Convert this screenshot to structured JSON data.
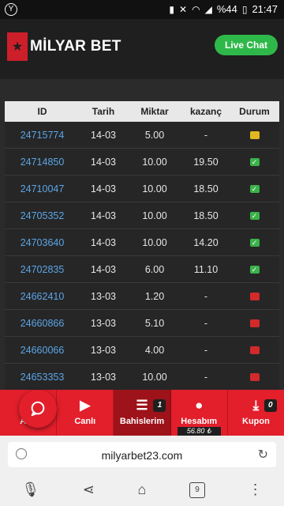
{
  "status_bar": {
    "battery": "%44",
    "time": "21:47"
  },
  "header": {
    "brand": "MİLYAR BET",
    "live_chat": "Live Chat"
  },
  "table": {
    "columns": [
      "ID",
      "Tarih",
      "Miktar",
      "kazanç",
      "Durum"
    ],
    "rows": [
      {
        "id": "24715774",
        "tarih": "14-03",
        "miktar": "5.00",
        "kazanc": "-",
        "durum": "pending"
      },
      {
        "id": "24714850",
        "tarih": "14-03",
        "miktar": "10.00",
        "kazanc": "19.50",
        "durum": "won"
      },
      {
        "id": "24710047",
        "tarih": "14-03",
        "miktar": "10.00",
        "kazanc": "18.50",
        "durum": "won"
      },
      {
        "id": "24705352",
        "tarih": "14-03",
        "miktar": "10.00",
        "kazanc": "18.50",
        "durum": "won"
      },
      {
        "id": "24703640",
        "tarih": "14-03",
        "miktar": "10.00",
        "kazanc": "14.20",
        "durum": "won"
      },
      {
        "id": "24702835",
        "tarih": "14-03",
        "miktar": "6.00",
        "kazanc": "11.10",
        "durum": "won"
      },
      {
        "id": "24662410",
        "tarih": "13-03",
        "miktar": "1.20",
        "kazanc": "-",
        "durum": "lost"
      },
      {
        "id": "24660866",
        "tarih": "13-03",
        "miktar": "5.10",
        "kazanc": "-",
        "durum": "lost"
      },
      {
        "id": "24660066",
        "tarih": "13-03",
        "miktar": "4.00",
        "kazanc": "-",
        "durum": "lost"
      },
      {
        "id": "24653353",
        "tarih": "13-03",
        "miktar": "10.00",
        "kazanc": "-",
        "durum": "lost"
      }
    ]
  },
  "bottom_nav": {
    "items": [
      {
        "label": "Ana",
        "icon": "home-icon"
      },
      {
        "label": "Canlı",
        "icon": "play-icon"
      },
      {
        "label": "Bahislerim",
        "icon": "list-icon",
        "badge": "1"
      },
      {
        "label": "Hesabım",
        "icon": "user-icon",
        "balance": "56.80 ₺"
      },
      {
        "label": "Kupon",
        "icon": "download-icon",
        "badge": "0"
      }
    ]
  },
  "browser": {
    "url": "milyarbet23.com",
    "tab_count": "9"
  },
  "colors": {
    "brand_red": "#e21f2b",
    "live_chat_green": "#2fb84a",
    "id_link_blue": "#5ba5e6"
  }
}
